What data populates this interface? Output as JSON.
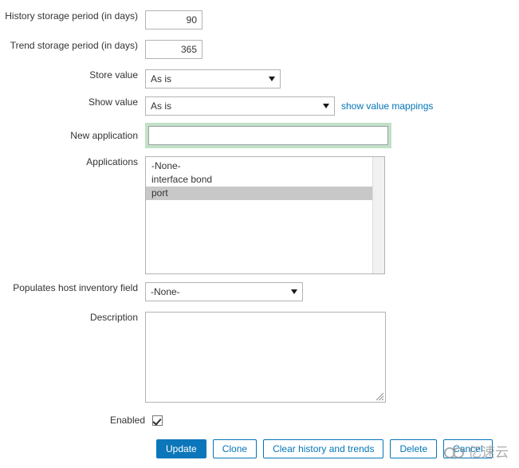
{
  "form": {
    "fields": {
      "history_storage": {
        "label": "History storage period (in days)",
        "value": "90"
      },
      "trend_storage": {
        "label": "Trend storage period (in days)",
        "value": "365"
      },
      "store_value": {
        "label": "Store value",
        "value": "As is"
      },
      "show_value": {
        "label": "Show value",
        "value": "As is",
        "link": "show value mappings"
      },
      "new_application": {
        "label": "New application",
        "value": "",
        "placeholder": ""
      },
      "applications": {
        "label": "Applications",
        "options": [
          {
            "text": "-None-",
            "selected": false
          },
          {
            "text": "interface bond",
            "selected": false
          },
          {
            "text": "port",
            "selected": true
          }
        ]
      },
      "host_inventory": {
        "label": "Populates host inventory field",
        "value": "-None-"
      },
      "description": {
        "label": "Description",
        "value": "",
        "placeholder": ""
      },
      "enabled": {
        "label": "Enabled",
        "checked": true
      }
    },
    "buttons": [
      {
        "label": "Update",
        "style": "primary"
      },
      {
        "label": "Clone",
        "style": "default"
      },
      {
        "label": "Clear history and trends",
        "style": "default"
      },
      {
        "label": "Delete",
        "style": "default"
      },
      {
        "label": "Cancel",
        "style": "default"
      }
    ]
  },
  "watermark": {
    "text": "亿速云"
  },
  "colors": {
    "accent": "#0275b8",
    "primary_button": "#0b76ba",
    "focus_ring": "#c3e1c8",
    "selected_row": "#c8c8c8",
    "border": "#b0b3b7",
    "text": "#333333"
  }
}
